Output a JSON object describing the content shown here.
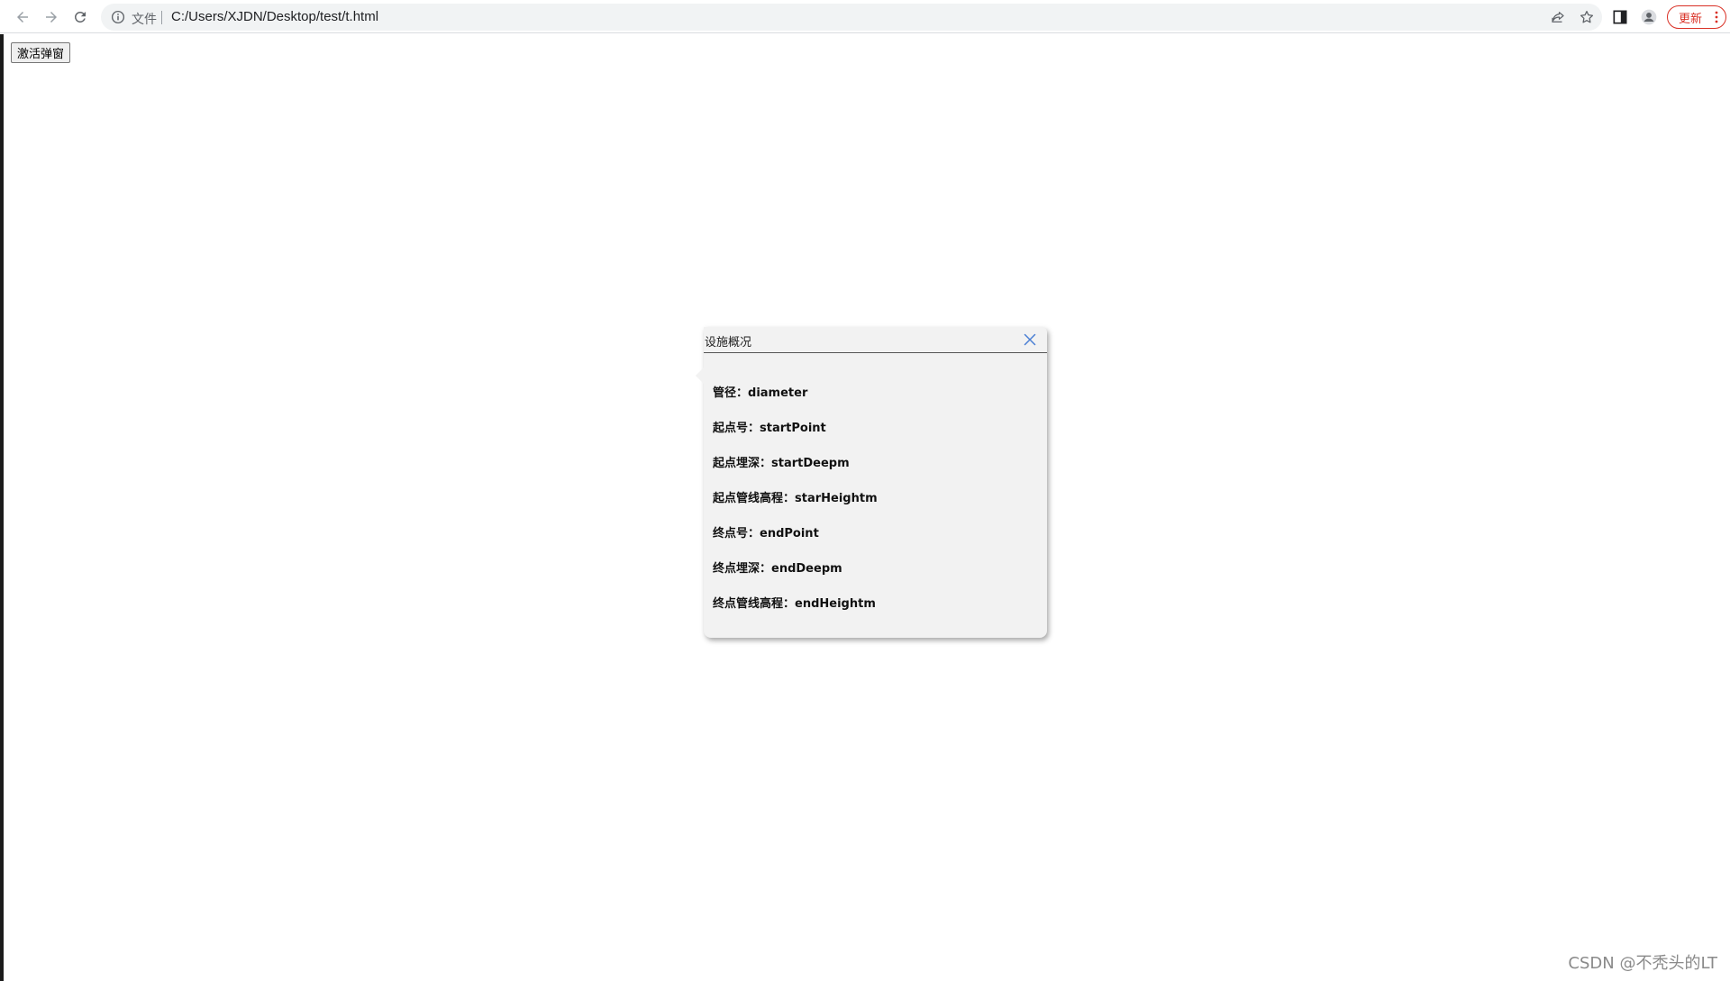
{
  "browser": {
    "scheme_label": "文件",
    "url": "C:/Users/XJDN/Desktop/test/t.html",
    "update_label": "更新",
    "icons": [
      "back-arrow-icon",
      "forward-arrow-icon",
      "reload-icon",
      "info-icon",
      "share-icon",
      "star-icon",
      "side-panel-icon",
      "profile-icon",
      "more-vert-icon"
    ]
  },
  "page": {
    "activate_button": "激活弹窗"
  },
  "popup": {
    "title": "设施概况",
    "fields": [
      {
        "label": "管径：",
        "value": "diameter"
      },
      {
        "label": "起点号：",
        "value": "startPoint"
      },
      {
        "label": "起点埋深：",
        "value": "startDeepm"
      },
      {
        "label": "起点管线高程：",
        "value": "starHeightm"
      },
      {
        "label": "终点号：",
        "value": "endPoint"
      },
      {
        "label": "终点埋深：",
        "value": "endDeepm"
      },
      {
        "label": "终点管线高程：",
        "value": "endHeightm"
      }
    ]
  },
  "watermark": "CSDN @不秃头的LT",
  "colors": {
    "close_icon": "#4a7fd4",
    "update_accent": "#d93025",
    "popup_bg": "#f2f2f2"
  }
}
